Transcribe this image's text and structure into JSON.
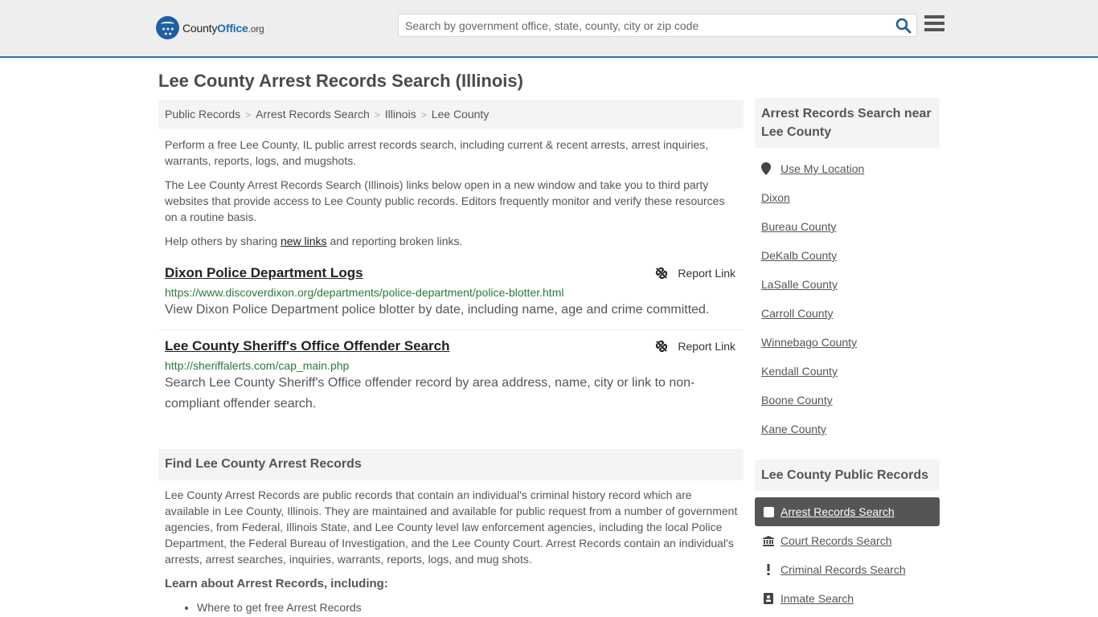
{
  "header": {
    "logo_text_county": "County",
    "logo_text_office": "Office",
    "logo_text_org": ".org",
    "search_placeholder": "Search by government office, state, county, city or zip code",
    "search_value": ""
  },
  "page_title": "Lee County Arrest Records Search (Illinois)",
  "breadcrumb": [
    {
      "label": "Public Records"
    },
    {
      "label": "Arrest Records Search"
    },
    {
      "label": "Illinois"
    },
    {
      "label": "Lee County"
    }
  ],
  "breadcrumb_separator": ">",
  "intro": {
    "p1": "Perform a free Lee County, IL public arrest records search, including current & recent arrests, arrest inquiries, warrants, reports, logs, and mugshots.",
    "p2": "The Lee County Arrest Records Search (Illinois) links below open in a new window and take you to third party websites that provide access to Lee County public records. Editors frequently monitor and verify these resources on a routine basis.",
    "p3_before": "Help others by sharing ",
    "p3_link": "new links",
    "p3_after": " and reporting broken links."
  },
  "results": [
    {
      "title": "Dixon Police Department Logs",
      "url": "https://www.discoverdixon.org/departments/police-department/police-blotter.html",
      "description": "View Dixon Police Department police blotter by date, including name, age and crime committed.",
      "report_label": "Report Link"
    },
    {
      "title": "Lee County Sheriff's Office Offender Search",
      "url": "http://sheriffalerts.com/cap_main.php",
      "description": "Search Lee County Sheriff's Office offender record by area address, name, city or link to non-compliant offender search.",
      "report_label": "Report Link"
    }
  ],
  "find_section": {
    "heading": "Find Lee County Arrest Records",
    "body": "Lee County Arrest Records are public records that contain an individual's criminal history record which are available in Lee County, Illinois. They are maintained and available for public request from a number of government agencies, from Federal, Illinois State, and Lee County level law enforcement agencies, including the local Police Department, the Federal Bureau of Investigation, and the Lee County Court. Arrest Records contain an individual's arrests, arrest searches, inquiries, warrants, reports, logs, and mug shots.",
    "learn_heading": "Learn about Arrest Records, including:",
    "learn_items": [
      "Where to get free Arrest Records"
    ]
  },
  "sidebar": {
    "nearby_heading": "Arrest Records Search near Lee County",
    "use_location": "Use My Location",
    "nearby": [
      "Dixon",
      "Bureau County",
      "DeKalb County",
      "LaSalle County",
      "Carroll County",
      "Winnebago County",
      "Kendall County",
      "Boone County",
      "Kane County"
    ],
    "public_records_heading": "Lee County Public Records",
    "public_records": [
      {
        "label": "Arrest Records Search",
        "icon": "square-icon",
        "active": true
      },
      {
        "label": "Court Records Search",
        "icon": "courthouse-icon",
        "active": false
      },
      {
        "label": "Criminal Records Search",
        "icon": "exclamation-icon",
        "active": false
      },
      {
        "label": "Inmate Search",
        "icon": "id-card-icon",
        "active": false
      }
    ]
  },
  "colors": {
    "brand_blue": "#1e6bb8",
    "header_border": "#2f76b0",
    "url_green": "#2a7a36",
    "active_bg": "#555555"
  }
}
